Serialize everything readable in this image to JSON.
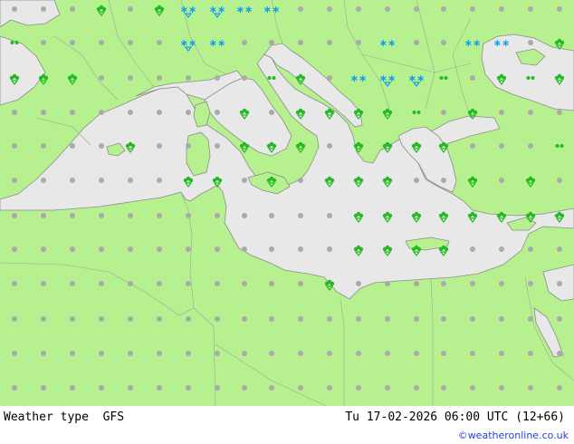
{
  "map": {
    "colors": {
      "land": "#b7f08e",
      "sea": "#e8e8e8",
      "border": "#9aa89a",
      "coast": "#8c8c8c",
      "rain": "#22bb22",
      "snow": "#11a0ee",
      "cloud": "#aaaaaa"
    },
    "legend_icons": [
      "rain-drizzle-icon",
      "rain-showers-icon",
      "snow-icon",
      "snow-showers-icon",
      "cloud-dot-icon",
      "partly-cloudy-icon",
      "clear-circle-icon"
    ]
  },
  "footer": {
    "title": "Weather type  GFS",
    "datetime": "Tu 17-02-2026 06:00 UTC (12+66)",
    "copyright": "©weatheronline.co.uk"
  }
}
